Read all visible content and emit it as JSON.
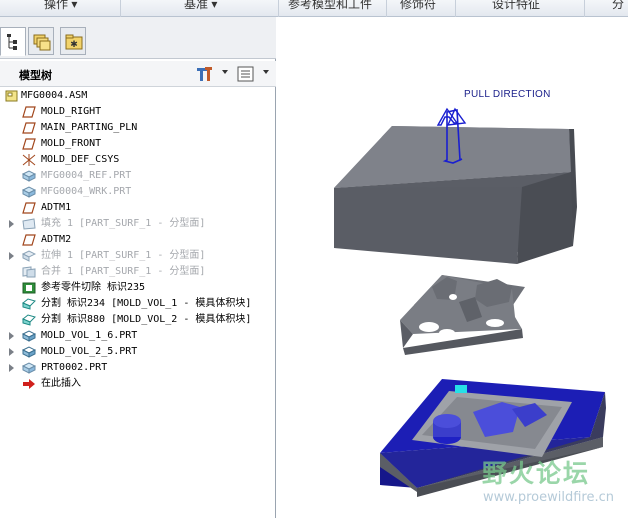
{
  "toolbar": {
    "groups": [
      "操作",
      "基准",
      "参考模型和工件",
      "修饰符",
      "设计特征",
      "分"
    ]
  },
  "tree": {
    "title": "模型树",
    "items": [
      {
        "label": "MFG0004.ASM",
        "icon": "assembly-icon",
        "muted": false,
        "expandable": false
      },
      {
        "label": "MOLD_RIGHT",
        "icon": "datum-plane-icon",
        "muted": false,
        "expandable": false
      },
      {
        "label": "MAIN_PARTING_PLN",
        "icon": "datum-plane-icon",
        "muted": false,
        "expandable": false
      },
      {
        "label": "MOLD_FRONT",
        "icon": "datum-plane-icon",
        "muted": false,
        "expandable": false
      },
      {
        "label": "MOLD_DEF_CSYS",
        "icon": "csys-icon",
        "muted": false,
        "expandable": false
      },
      {
        "label": "MFG0004_REF.PRT",
        "icon": "part-icon",
        "muted": true,
        "expandable": false
      },
      {
        "label": "MFG0004_WRK.PRT",
        "icon": "part-icon",
        "muted": true,
        "expandable": false
      },
      {
        "label": "ADTM1",
        "icon": "datum-plane-icon",
        "muted": false,
        "expandable": false
      },
      {
        "label": "填充 1 [PART_SURF_1 - 分型面]",
        "icon": "fill-surface-icon",
        "muted": true,
        "expandable": true
      },
      {
        "label": "ADTM2",
        "icon": "datum-plane-icon",
        "muted": false,
        "expandable": false
      },
      {
        "label": "拉伸 1 [PART_SURF_1 - 分型面]",
        "icon": "extrude-surface-icon",
        "muted": true,
        "expandable": true
      },
      {
        "label": "合并 1 [PART_SURF_1 - 分型面]",
        "icon": "merge-surface-icon",
        "muted": true,
        "expandable": false
      },
      {
        "label": "参考零件切除 标识235",
        "icon": "ref-part-cutout-icon",
        "muted": false,
        "expandable": false
      },
      {
        "label": "分割 标识234 [MOLD_VOL_1 - 模具体积块]",
        "icon": "split-volume-icon",
        "muted": false,
        "expandable": false
      },
      {
        "label": "分割 标识880 [MOLD_VOL_2 - 模具体积块]",
        "icon": "split-volume-icon",
        "muted": false,
        "expandable": false
      },
      {
        "label": "MOLD_VOL_1_6.PRT",
        "icon": "mold-component-icon",
        "muted": false,
        "expandable": true
      },
      {
        "label": "MOLD_VOL_2_5.PRT",
        "icon": "mold-component-icon",
        "muted": false,
        "expandable": true
      },
      {
        "label": "PRT0002.PRT",
        "icon": "part-icon",
        "muted": false,
        "expandable": true
      },
      {
        "label": "在此插入",
        "icon": "insert-here-arrow-icon",
        "muted": false,
        "expandable": false
      }
    ]
  },
  "viewport": {
    "pull_direction_label": "PULL DIRECTION",
    "watermark_text": "野火论坛",
    "watermark_url": "www.proewildfire.cn"
  },
  "colors": {
    "block_top": "#7a7d84",
    "block_front": "#5b5e66",
    "block_side": "#484b52",
    "cavity_blue": "#1c1eb5",
    "arrow_blue": "#1a1fd0"
  }
}
